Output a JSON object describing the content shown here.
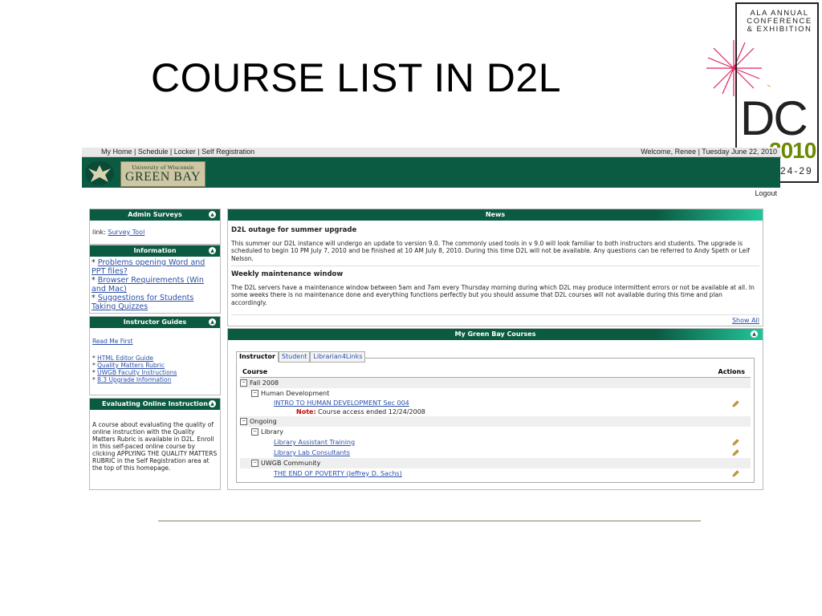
{
  "slide": {
    "title": "COURSE LIST IN D2L"
  },
  "logo": {
    "lines": [
      "ALA ANNUAL",
      "CONFERENCE",
      "& EXHIBITION"
    ],
    "dc": "DC",
    "year": "2010",
    "dates": "24-29"
  },
  "topbar": {
    "nav": [
      "My Home",
      "Schedule",
      "Locker",
      "Self Registration"
    ],
    "separator": " | ",
    "welcome": "Welcome, Renee | Tuesday June 22, 2010"
  },
  "banner": {
    "line1": "University of Wisconsin",
    "line2": "GREEN BAY"
  },
  "logout": "Logout",
  "widgets": {
    "admin": {
      "title": "Admin Surveys",
      "prefix": "link: ",
      "link": "Survey Tool"
    },
    "info": {
      "title": "Information",
      "items": [
        "Problems opening Word and PPT files?",
        "Browser Requirements (Win and Mac)",
        "Suggestions for Students Taking Quizzes"
      ]
    },
    "guides": {
      "title": "Instructor Guides",
      "first": "Read Me First",
      "items": [
        "HTML Editor Guide",
        "Quality Matters Rubric",
        "UWGB Faculty Instructions",
        "8.3 Upgrade Information"
      ]
    },
    "evaluating": {
      "title": "Evaluating Online Instruction",
      "body": "A course about evaluating the quality of online instruction with the Quality Matters Rubric is available in D2L. Enroll in this self-paced online course by clicking APPLYING THE QUALITY MATTERS RUBRIC in the Self Registration area at the top of this homepage."
    }
  },
  "news": {
    "title": "News",
    "items": [
      {
        "title": "D2L outage for summer upgrade",
        "body": "This summer our D2L instance will undergo an update to version 9.0. The commonly used tools in v 9.0 will look familiar to both instructors and students. The upgrade is scheduled to begin 10 PM July 7, 2010 and be finished at 10 AM July 8, 2010. During this time D2L will not be available. Any questions can be referred to Andy Speth or Leif Nelson."
      },
      {
        "title": "Weekly maintenance window",
        "body": "The D2L servers have a maintenance window between 5am and 7am every Thursday morning during which D2L may produce intermittent errors or not be available at all.  In some weeks there is no maintenance done and everything functions perfectly but you should assume that D2L courses will not available during this time and plan accordingly."
      }
    ],
    "show_all": "Show All"
  },
  "courses": {
    "title": "My Green Bay Courses",
    "tabs": [
      "Instructor",
      "Student",
      "Librarian4Links"
    ],
    "col_course": "Course",
    "col_actions": "Actions",
    "fall": "Fall 2008",
    "human_dev": "Human Development",
    "course1": "INTRO TO HUMAN DEVELOPMENT Sec 004",
    "note_label": "Note:",
    "note_text": " Course access ended 12/24/2008",
    "ongoing": "Ongoing",
    "library": "Library",
    "course2": "Library Assistant Training",
    "course3": "Library Lab Consultants",
    "community": "UWGB Community",
    "course4": "THE END OF POVERTY (Jeffrey D. Sachs)"
  },
  "colors": {
    "green": "#0b5a42",
    "teal": "#23c59a",
    "link": "#2a4fa8",
    "note": "#cc0000"
  }
}
